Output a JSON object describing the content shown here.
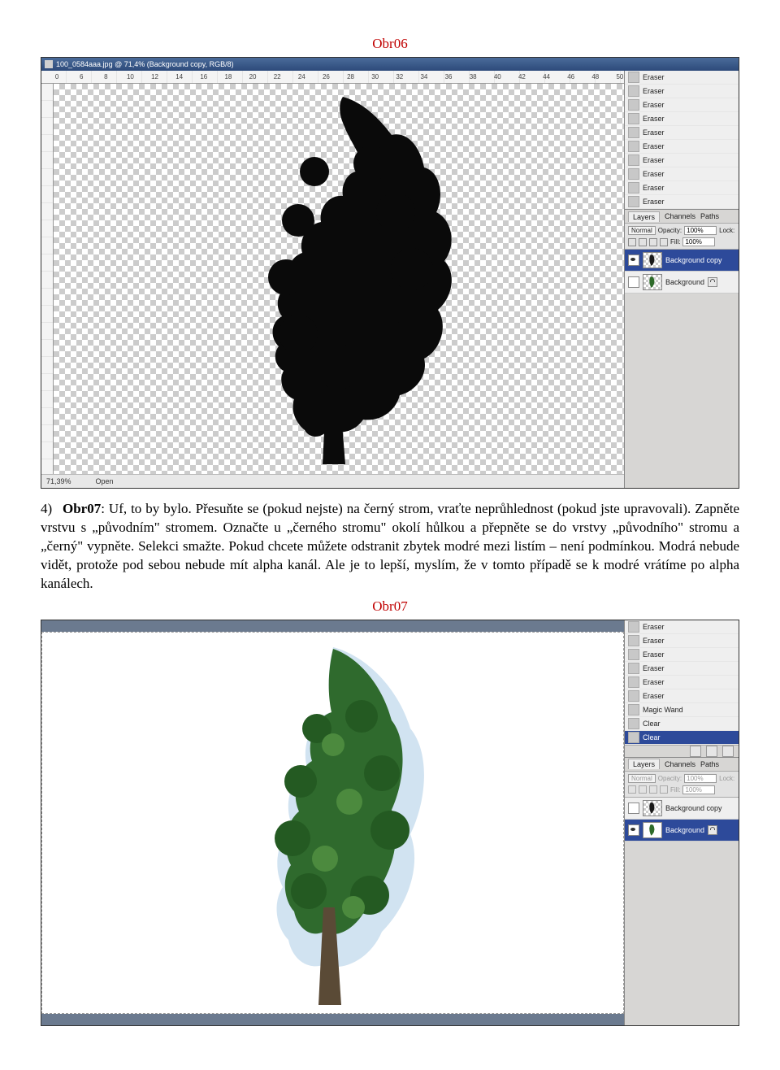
{
  "fig1_label": "Obr06",
  "fig2_label": "Obr07",
  "paragraph": {
    "num": "4)",
    "lead": "Obr07",
    "text": ": Uf, to by bylo. Přesuňte se (pokud nejste) na černý strom, vraťte neprůhlednost (pokud jste upravovali). Zapněte vrstvu s „původním\" stromem. Označte u „černého stromu\" okolí hůlkou a přepněte se do vrstvy „původního\" stromu a „černý\" vypněte. Selekci smažte. Pokud chcete můžete odstranit zbytek modré mezi listím – není podmínkou. Modrá nebude vidět, protože pod sebou nebude mít alpha kanál. Ale je to lepší, myslím, že v tomto případě se k modré vrátíme po alpha kanálech."
  },
  "shot1": {
    "title": "100_0584aaa.jpg @ 71,4% (Background copy, RGB/8)",
    "ruler_marks": [
      "0",
      "6",
      "8",
      "10",
      "12",
      "14",
      "16",
      "18",
      "20",
      "22",
      "24",
      "26",
      "28",
      "30",
      "32",
      "34",
      "36",
      "38",
      "40",
      "42",
      "44",
      "46",
      "48",
      "50"
    ],
    "status_zoom": "71,39%",
    "status_tool": "Open",
    "history": [
      "Eraser",
      "Eraser",
      "Eraser",
      "Eraser",
      "Eraser",
      "Eraser",
      "Eraser",
      "Eraser",
      "Eraser",
      "Eraser",
      "Eraser"
    ],
    "history_selected": "Eraser",
    "layers_tabs": [
      "Layers",
      "Channels",
      "Paths"
    ],
    "blend_mode": "Normal",
    "opacity_label": "Opacity:",
    "opacity_value": "100%",
    "lock_label": "Lock:",
    "fill_label": "Fill:",
    "fill_value": "100%",
    "layers": [
      {
        "name": "Background copy",
        "selected": true,
        "locked": false
      },
      {
        "name": "Background",
        "selected": false,
        "locked": true
      }
    ]
  },
  "shot2": {
    "history": [
      "Eraser",
      "Eraser",
      "Eraser",
      "Eraser",
      "Eraser",
      "Eraser",
      "Magic Wand",
      "Clear"
    ],
    "history_selected": "Clear",
    "layers_tabs": [
      "Layers",
      "Channels",
      "Paths"
    ],
    "blend_mode": "Normal",
    "opacity_label": "Opacity:",
    "opacity_value": "100%",
    "lock_label": "Lock:",
    "fill_label": "Fill:",
    "fill_value": "100%",
    "layers": [
      {
        "name": "Background copy",
        "selected": false,
        "locked": false
      },
      {
        "name": "Background",
        "selected": true,
        "locked": true
      }
    ]
  }
}
